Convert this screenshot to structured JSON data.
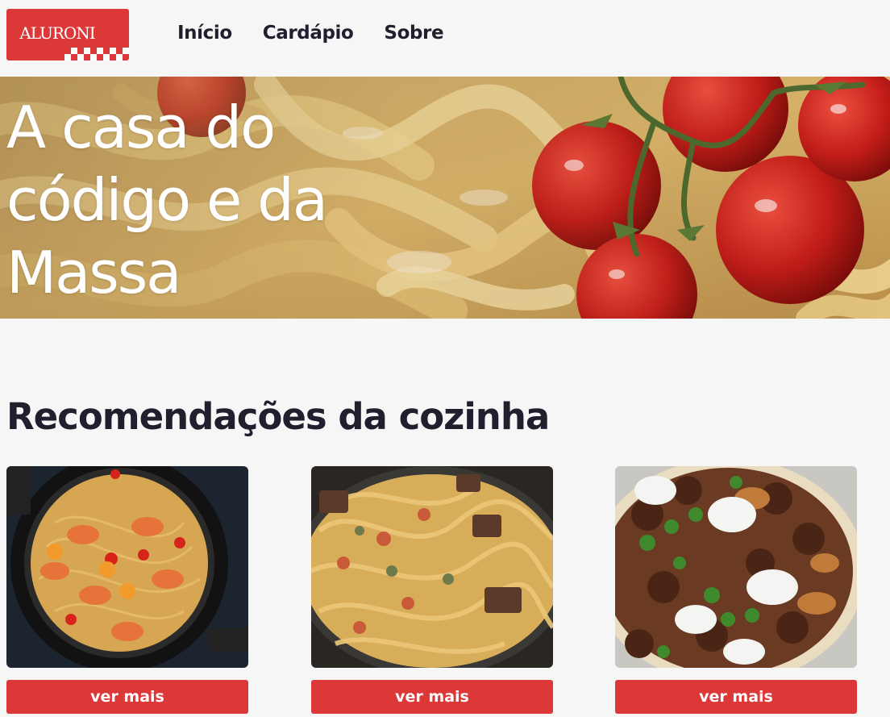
{
  "brand": {
    "name": "ALURONI",
    "color": "#dc3838"
  },
  "nav": {
    "items": [
      {
        "label": "Início"
      },
      {
        "label": "Cardápio"
      },
      {
        "label": "Sobre"
      }
    ]
  },
  "hero": {
    "title": "A casa do código e da Massa"
  },
  "recommendations": {
    "title": "Recomendações da cozinha",
    "cards": [
      {
        "button_label": "ver mais"
      },
      {
        "button_label": "ver mais"
      },
      {
        "button_label": "ver mais"
      }
    ]
  }
}
